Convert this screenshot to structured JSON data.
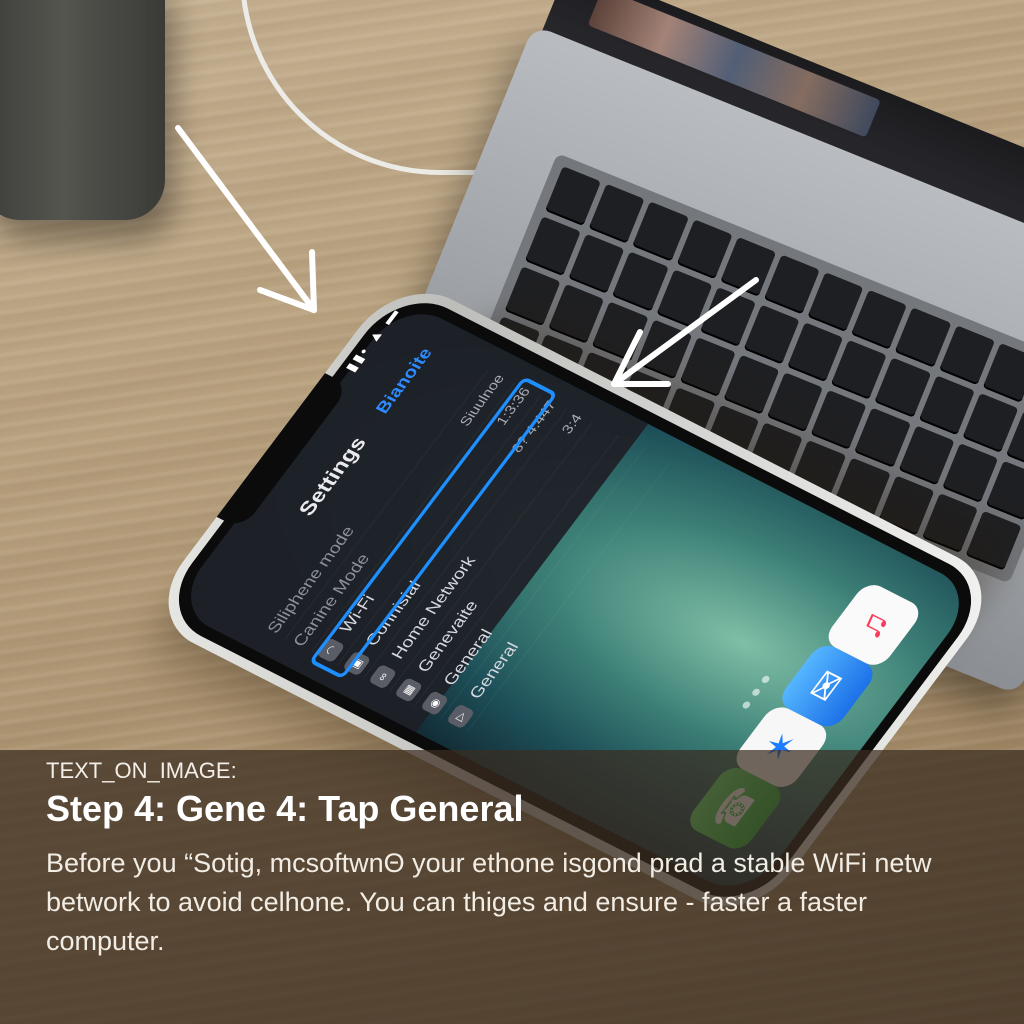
{
  "phone_screen": {
    "status_icons": "▮▮• ▲ ▬",
    "settings_title": "Settings",
    "settings_action": "Bianoite",
    "rows": [
      {
        "label": "Siliphene mode",
        "value": "",
        "icon": "",
        "faint": true
      },
      {
        "label": "Canine Mode",
        "value": "Siuulnoe",
        "icon": "",
        "faint": true
      },
      {
        "label": "Wi-Fi",
        "value": "1:3:36",
        "icon": "wifi-icon"
      },
      {
        "label": "Connisial",
        "value": "8? 4:447",
        "icon": "camera-icon"
      },
      {
        "label": "Home Network",
        "value": "3:4",
        "icon": "link-icon"
      },
      {
        "label": "Genevaite",
        "value": "",
        "icon": "calculator-icon"
      },
      {
        "label": "General",
        "value": "",
        "icon": "car-icon"
      },
      {
        "label": "General",
        "value": "",
        "icon": "play-icon"
      }
    ],
    "dock_apps": [
      {
        "name": "phone",
        "glyph": "☎"
      },
      {
        "name": "safari",
        "glyph": "✶"
      },
      {
        "name": "mail",
        "glyph": "✉"
      },
      {
        "name": "music",
        "glyph": "♫"
      }
    ]
  },
  "caption": {
    "tag": "TEXT_ON_IMAGE:",
    "title": "Step 4: Gene 4: Tap General",
    "body_lines": [
      "Before you “Sotig, mcsoftwnΘ your ethone isgond prad a stable WiFi netw",
      "betwork to avoid celhone. You can thiges and ensure - faster a faster",
      "computer."
    ]
  },
  "colors": {
    "highlight": "#1e8fff",
    "caption_bg": "#3a2d20",
    "arrow": "#ffffff"
  }
}
